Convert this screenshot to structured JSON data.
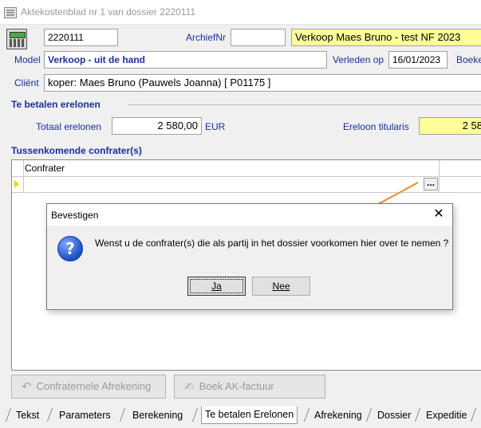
{
  "window": {
    "title": "Aktekostenblad nr 1 van dossier 2220111"
  },
  "header": {
    "dossier_nr": "2220111",
    "archief_label": "ArchiefNr",
    "archief_value": "",
    "dossier_title": "Verkoop Maes Bruno - test NF 2023",
    "model_label": "Model",
    "model_value": "Verkoop - uit de hand",
    "verleden_label": "Verleden op",
    "verleden_value": "16/01/2023",
    "boek_label": "Boeke",
    "client_label": "Cliënt",
    "client_value": "koper: Maes Bruno (Pauwels Joanna) [ P01175 ]"
  },
  "erelonen": {
    "section_title": "Te betalen erelonen",
    "totaal_label": "Totaal erelonen",
    "totaal_value": "2 580,00",
    "currency": "EUR",
    "titularis_label": "Ereloon titularis",
    "titularis_value": "2 58"
  },
  "confraters": {
    "section_title": "Tussenkomende confrater(s)",
    "column_header": "Confrater",
    "ellipsis": "..."
  },
  "dialog": {
    "title": "Bevestigen",
    "close": "✕",
    "icon": "question-icon",
    "icon_glyph": "?",
    "message": "Wenst u de confrater(s) die als partij in het dossier voorkomen hier over te nemen ?",
    "yes": "Ja",
    "no": "Nee"
  },
  "buttons": {
    "afrekening": "Confraternele Afrekening",
    "boek": "Boek AK-factuur"
  },
  "tabs": [
    "Tekst",
    "Parameters",
    "Berekening",
    "Te betalen Erelonen",
    "Afrekening",
    "Dossier",
    "Expeditie"
  ],
  "colors": {
    "highlight": "#ffff99",
    "label": "#1a2fa0",
    "arrow": "#f08a24"
  }
}
